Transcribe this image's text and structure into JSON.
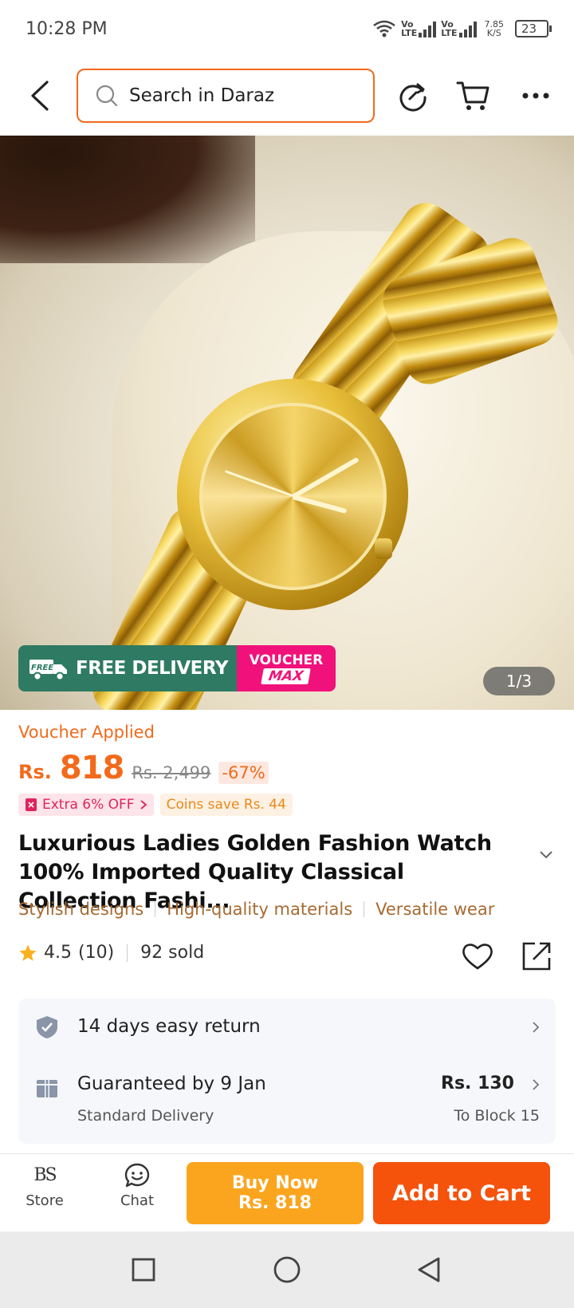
{
  "status_bar": {
    "time": "10:28 PM",
    "sim1": [
      "Vo",
      "LTE"
    ],
    "sim2": [
      "Vo",
      "LTE"
    ],
    "speed_value": "7.85",
    "speed_unit": "K/S",
    "battery": "23"
  },
  "header": {
    "search_placeholder": "Search in Daraz",
    "icons": [
      "back-icon",
      "search-icon",
      "share-refresh-icon",
      "cart-icon",
      "more-icon"
    ]
  },
  "hero": {
    "free_delivery_tag": "FREE",
    "free_delivery": "FREE DELIVERY",
    "voucher_top": "VOUCHER",
    "voucher_bottom": "MAX",
    "image_counter": "1/3"
  },
  "price": {
    "voucher_applied": "Voucher Applied",
    "currency": "Rs.",
    "current": "818",
    "original": "Rs. 2,499",
    "discount": "-67%",
    "extra_off": "Extra 6% OFF",
    "coins_save": "Coins save Rs. 44"
  },
  "product": {
    "title": "Luxurious Ladies Golden Fashion Watch 100% Imported Quality Classical Collection Fashi...",
    "features": [
      "Stylish designs",
      "High-quality materials",
      "Versatile wear"
    ],
    "rating": "4.5",
    "rating_count": "(10)",
    "sold": "92 sold"
  },
  "services": {
    "return": "14 days easy return",
    "delivery_title": "Guaranteed by 9 Jan",
    "delivery_type": "Standard Delivery",
    "delivery_price": "Rs. 130",
    "delivery_to": "To Block 15"
  },
  "bottom_bar": {
    "store_logo": "BS",
    "store": "Store",
    "chat": "Chat",
    "buy_now": "Buy Now",
    "buy_now_price": "Rs. 818",
    "add_to_cart": "Add to Cart"
  },
  "colors": {
    "brand": "#f26a1b",
    "buy_now": "#fba51f",
    "add_to_cart": "#f5520c",
    "free_delivery": "#2f7a62",
    "voucher_max": "#f0127a"
  }
}
